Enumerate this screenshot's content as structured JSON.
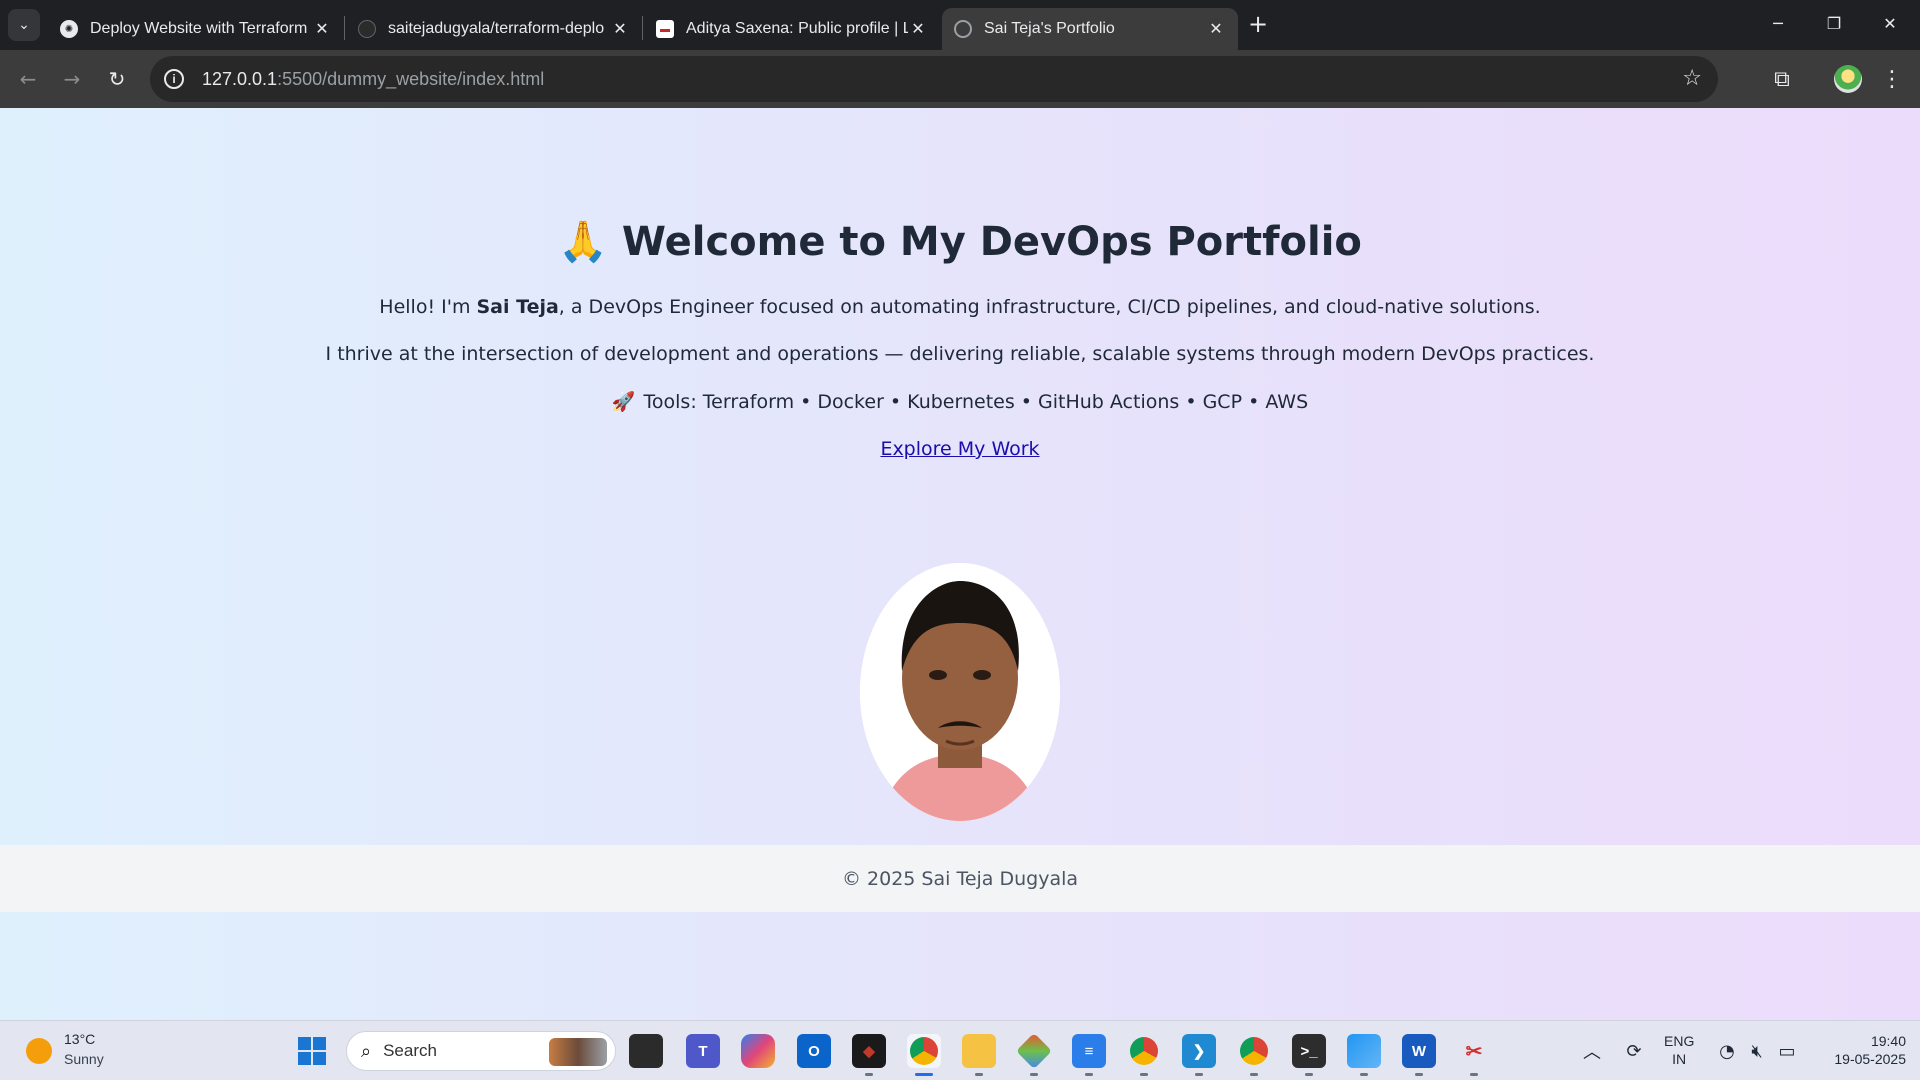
{
  "browser": {
    "tabs": [
      {
        "title": "Deploy Website with Terraform",
        "favicon": "openai-icon",
        "active": false
      },
      {
        "title": "saitejadugyala/terraform-deplo",
        "favicon": "github-icon",
        "active": false
      },
      {
        "title": "Aditya Saxena: Public profile | Li",
        "favicon": "profile-site-icon",
        "active": false
      },
      {
        "title": "Sai Teja's Portfolio",
        "favicon": "globe-icon",
        "active": true
      }
    ],
    "address": {
      "host": "127.0.0.1",
      "path": ":5500/dummy_website/index.html"
    }
  },
  "page": {
    "heading_emoji": "🙏",
    "heading": "Welcome to My DevOps Portfolio",
    "intro": {
      "prefix": "Hello! I'm ",
      "name": "Sai Teja",
      "suffix": ", a DevOps Engineer focused on automating infrastructure, CI/CD pipelines, and cloud-native solutions."
    },
    "tagline": "I thrive at the intersection of development and operations — delivering reliable, scalable systems through modern DevOps practices.",
    "tools_emoji": "🚀",
    "tools": "Tools: Terraform • Docker • Kubernetes • GitHub Actions • GCP • AWS",
    "cta_label": "Explore My Work",
    "footer": "© 2025 Sai Teja Dugyala"
  },
  "taskbar": {
    "weather": {
      "temp": "13°C",
      "condition": "Sunny"
    },
    "search_label": "Search",
    "apps": [
      "file-explorer-icon",
      "teams-icon",
      "copilot-icon",
      "outlook-icon",
      "predator-icon",
      "chrome-icon",
      "folder-icon",
      "git-icon",
      "notepad-icon",
      "chrome-profile-icon",
      "vscode-icon",
      "chrome-profile-2-icon",
      "terminal-icon",
      "paint-icon",
      "word-icon",
      "snipping-tool-icon"
    ],
    "language": {
      "line1": "ENG",
      "line2": "IN"
    },
    "time": "19:40",
    "date": "19-05-2025"
  },
  "colors": {
    "accent_link": "#1a0dab",
    "heading_text": "#1f2937",
    "bg_gradient_start": "#dff0fd",
    "bg_gradient_end": "#ecdcfb"
  }
}
